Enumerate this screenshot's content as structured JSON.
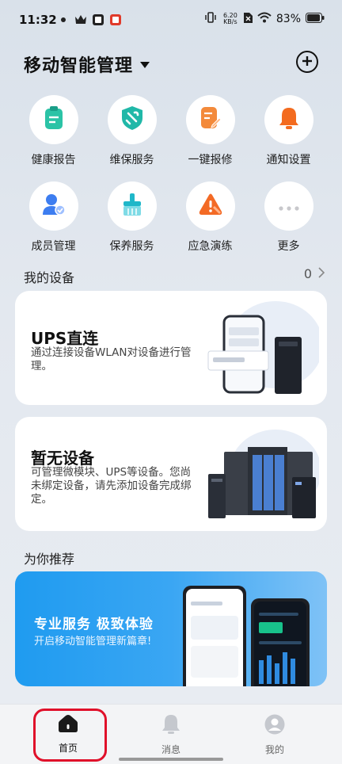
{
  "status_bar": {
    "time": "11:32",
    "net_speed_value": "6.20",
    "net_speed_unit": "KB/s",
    "battery_percent": "83%"
  },
  "header": {
    "title": "移动智能管理"
  },
  "quick_actions": [
    {
      "label": "健康报告",
      "icon": "clipboard-icon",
      "color": "#2bc3a6"
    },
    {
      "label": "维保服务",
      "icon": "shield-wrench-icon",
      "color": "#20b8a8"
    },
    {
      "label": "一键报修",
      "icon": "document-edit-icon",
      "color": "#f38a3b"
    },
    {
      "label": "通知设置",
      "icon": "bell-icon",
      "color": "#f36b1f"
    },
    {
      "label": "成员管理",
      "icon": "user-check-icon",
      "color": "#3d7df0"
    },
    {
      "label": "保养服务",
      "icon": "brush-icon",
      "color": "#1fb7c9"
    },
    {
      "label": "应急演练",
      "icon": "warning-triangle-icon",
      "color": "#f36a25"
    },
    {
      "label": "更多",
      "icon": "more-dots-icon",
      "color": "#c8c8cc"
    }
  ],
  "devices_section": {
    "title": "我的设备",
    "count": "0"
  },
  "ups_card": {
    "title": "UPS直连",
    "description": "通过连接设备WLAN对设备进行管理。"
  },
  "no_device_card": {
    "title": "暂无设备",
    "description": "可管理微模块、UPS等设备。您尚未绑定设备，请先添加设备完成绑定。"
  },
  "recommend_section": {
    "title": "为你推荐"
  },
  "banner": {
    "title": "专业服务  极致体验",
    "subtitle": "开启移动智能管理新篇章!"
  },
  "tab_bar": {
    "tabs": [
      {
        "label": "首页",
        "active": true
      },
      {
        "label": "消息",
        "active": false
      },
      {
        "label": "我的",
        "active": false
      }
    ]
  },
  "colors": {
    "accent_highlight": "#e0102a",
    "banner_blue": "#1f9bf0"
  }
}
